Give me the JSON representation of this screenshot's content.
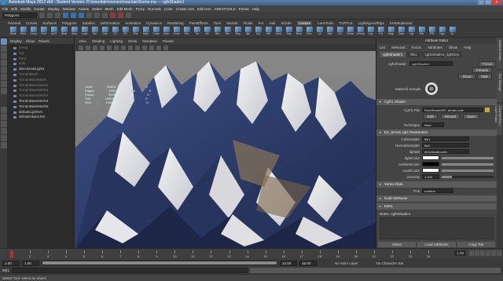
{
  "window": {
    "title": "Autodesk Maya 2012 x64 - Student Version: D:\\mountain\\scenes\\mountainScene.ma  --- cgfxShader1"
  },
  "menubar": [
    "File",
    "Edit",
    "Modify",
    "Create",
    "Display",
    "Window",
    "Assets",
    "Select",
    "Mesh",
    "Edit Mesh",
    "Proxy",
    "Normals",
    "Color",
    "Create UVs",
    "Edit UVs",
    "AREATOOLS",
    "Preset",
    "Help"
  ],
  "statusline": {
    "menuset": "Polygons"
  },
  "shelf": {
    "tabs": [
      "General",
      "Curves",
      "Surfaces",
      "Polygons",
      "Subdivs",
      "Deformation",
      "Animation",
      "Dynamics",
      "Rendering",
      "PaintEffects",
      "Toon",
      "Muscle",
      "Fluids",
      "Fur",
      "Hair",
      "nCloth",
      "Custom",
      "LensTools",
      "TURTLE",
      "LightingAndRigs",
      "SHnModerator"
    ],
    "active_tab": "Custom",
    "icons": [
      "Modl",
      "Recl",
      "Conn",
      "Pref",
      "ActT",
      "Shdr",
      "Aniu",
      "Lock",
      "Sel",
      "Chk",
      "CV",
      "EP",
      "Pnt",
      "Sphr",
      "Cube",
      "Cyln",
      "Cone",
      "Pln",
      "Tor",
      "Xtr",
      "Bvl",
      "Sm",
      "Mrg",
      "Spl",
      "Cut",
      "Mir",
      "Cmb",
      "Sep",
      "Bool",
      "Rev",
      "Lft",
      "Mat",
      "UV",
      "UVsel",
      "UVcop",
      "Lay",
      "Prj",
      "Map",
      "Cam",
      "Lgt",
      "Rdr",
      "IPR",
      "Hyp",
      "Ex"
    ]
  },
  "outliner": {
    "menu": [
      "Display",
      "Show",
      "Panels"
    ],
    "items": [
      {
        "label": "persp",
        "dim": true
      },
      {
        "label": "top",
        "dim": true
      },
      {
        "label": "front",
        "dim": true
      },
      {
        "label": "side",
        "dim": true
      },
      {
        "label": "directionalLight1",
        "dim": false
      },
      {
        "label": "TerrainMesh",
        "dim": true
      },
      {
        "label": "TerrainBaseMesh",
        "dim": true
      },
      {
        "label": "TerrainBaseMesh1",
        "dim": true
      },
      {
        "label": "TerrainBaseMesh2",
        "dim": true
      },
      {
        "label": "TerrainBaseMesh3",
        "dim": true
      },
      {
        "label": "TerrainBaseMesh4",
        "dim": false
      },
      {
        "label": "TerrainBaseMesh5",
        "dim": false
      },
      {
        "label": "defaultLightSet",
        "dim": false
      },
      {
        "label": "defaultObjectSet",
        "dim": false
      }
    ]
  },
  "viewport": {
    "menu": [
      "View",
      "Shading",
      "Lighting",
      "Show",
      "Renderer",
      "Panels"
    ],
    "stats": [
      {
        "label": "Verts:",
        "v1": "99819",
        "v2": "0",
        "v3": "0"
      },
      {
        "label": "Edges:",
        "v1": "199278",
        "v2": "0",
        "v3": "0"
      },
      {
        "label": "Faces:",
        "v1": "99460",
        "v2": "0",
        "v3": "0"
      },
      {
        "label": "Tris:",
        "v1": "198920",
        "v2": "0",
        "v3": "0"
      },
      {
        "label": "UVs:",
        "v1": "100819",
        "v2": "0",
        "v3": "0"
      }
    ]
  },
  "attribute_editor": {
    "header": "Attribute Editor",
    "menu": [
      "List",
      "Selected",
      "Focus",
      "Attributes",
      "Show",
      "Help"
    ],
    "tabs": [
      "cgfxShader1",
      "file1",
      "cgfxShader1_lightGrp"
    ],
    "active_tab": "cgfxShader1",
    "node_label": "cgfxShader:",
    "node_value": "cgfxShader1",
    "focus_btn": "Focus",
    "presets_btn": "Presets",
    "show_btn": "Show",
    "hide_btn": "Hide",
    "material_sample": "Material Sample",
    "cgfx_section": "CgFX Shader",
    "cgfx_file_label": "CgFX File",
    "cgfx_file_value": "RootShader\\ES_terrain.cgfx",
    "edit_btn": "Edit",
    "reload_btn": "Reload",
    "open_btn": "Open",
    "technique_label": "Technique",
    "technique_value": "Main",
    "params_section": "ES_terrain.cgfx Parameters",
    "params": [
      {
        "label": "ColSampler",
        "value": "file1"
      },
      {
        "label": "NormalSampler",
        "value": "file2"
      },
      {
        "label": "lightdir",
        "value": "directionalLight1"
      },
      {
        "label": "lightColor",
        "value": "",
        "swatch": "#ffffff"
      },
      {
        "label": "ambientColor",
        "value": "",
        "swatch": "#000000"
      },
      {
        "label": "maskColor",
        "value": "",
        "swatch": "#ffffff"
      },
      {
        "label": "intensity",
        "value": "1.000",
        "slider": 0.2
      }
    ],
    "vertex_section": "Vertex Data",
    "vertex_label": "Pos",
    "vertex_value": "position",
    "node_behavior": "Node Behavior",
    "extra": "Extra",
    "notes_label": "Notes: cgfxShader1",
    "bottom_buttons": [
      "Select",
      "Load Attributes",
      "Copy Tab"
    ]
  },
  "side_tabs": [
    "Attribute Editor",
    "Tool Settings",
    "Channel Box / Layer Editor"
  ],
  "timeslider": {
    "ticks": [
      "1",
      "2",
      "3",
      "4",
      "5",
      "6",
      "7",
      "8",
      "9",
      "10",
      "11",
      "12",
      "13",
      "14",
      "15",
      "16",
      "17",
      "18",
      "19",
      "20",
      "21",
      "22",
      "23",
      "24"
    ],
    "current_frame": "1.00",
    "current_frame_fraction": 0.0
  },
  "rangeslider": {
    "start": "1.00",
    "inner_start": "1.00",
    "inner_end": "24.00",
    "end": "48.00",
    "anim_layer": "No Anim Layer",
    "char_set": "No Character Set"
  },
  "commandline": {
    "lang": "MEL"
  },
  "helpline": "Select Tool: select an object"
}
